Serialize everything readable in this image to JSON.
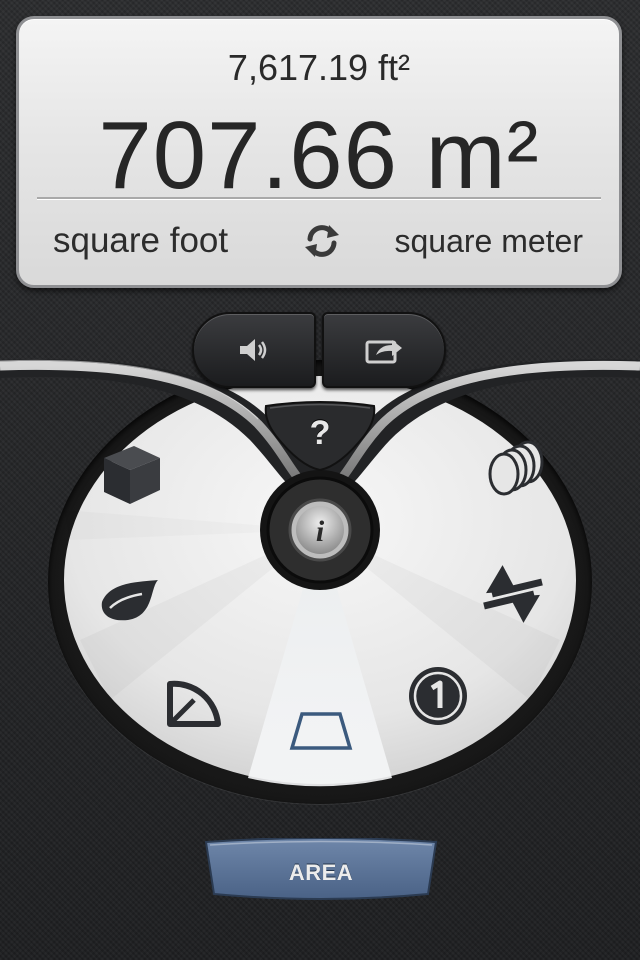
{
  "display": {
    "secondary_value": "7,617.19 ft²",
    "primary_value": "707.66 m²",
    "unit_from": "square foot",
    "unit_to": "square meter"
  },
  "buttons": {
    "sound_icon": "speaker-icon",
    "share_icon": "share-icon",
    "help_label": "?",
    "info_label": "i"
  },
  "wheel": {
    "categories": [
      {
        "name": "volume",
        "icon": "cube-icon"
      },
      {
        "name": "liquid",
        "icon": "drop-icon"
      },
      {
        "name": "angle",
        "icon": "protractor-icon"
      },
      {
        "name": "area",
        "icon": "trapezoid-icon",
        "selected": true
      },
      {
        "name": "currency",
        "icon": "coin-icon"
      },
      {
        "name": "exchange",
        "icon": "swap-arrows-icon"
      },
      {
        "name": "stack",
        "icon": "coins-stack-icon"
      }
    ]
  },
  "category_tab": {
    "label": "AREA"
  },
  "colors": {
    "tab_blue": "#5a7295",
    "icon_dark": "#2b2d31",
    "selected_outline": "#3b5a7e"
  }
}
